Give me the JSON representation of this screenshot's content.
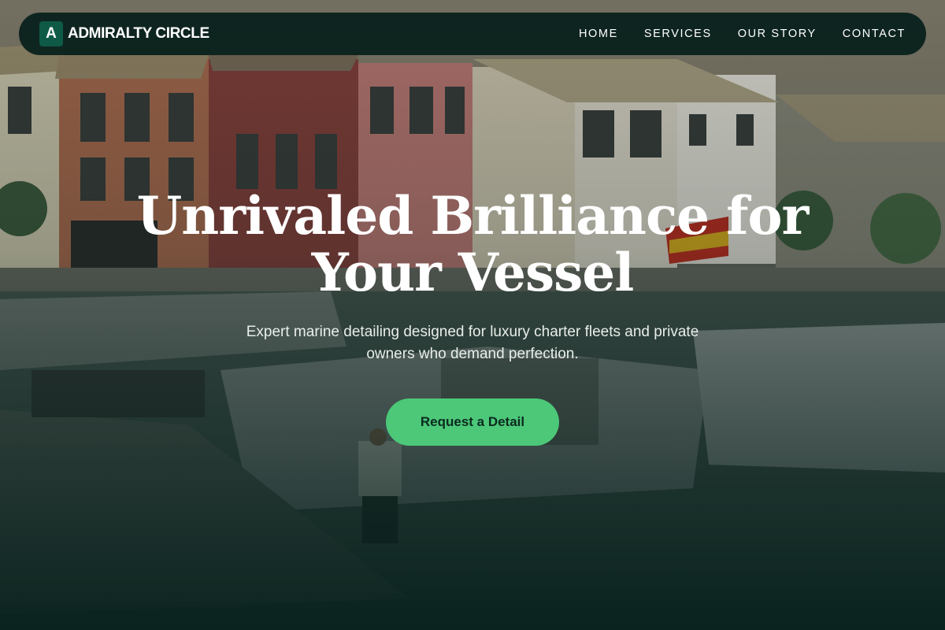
{
  "brand": {
    "mark": "A",
    "name": "ADMIRALTY CIRCLE"
  },
  "nav": {
    "items": [
      {
        "label": "HOME"
      },
      {
        "label": "SERVICES"
      },
      {
        "label": "OUR STORY"
      },
      {
        "label": "CONTACT"
      }
    ]
  },
  "hero": {
    "title_line1": "Unrivaled Brilliance for",
    "title_line2": "Your Vessel",
    "subtitle_line1": "Expert marine detailing designed for luxury charter fleets and private",
    "subtitle_line2": "owners who demand perfection.",
    "cta_label": "Request a Detail"
  },
  "colors": {
    "nav_background": "#061e1b",
    "brand_mark": "#0e5a46",
    "cta": "#4cc878",
    "cta_text": "#0c2a20",
    "text": "#ffffff"
  }
}
